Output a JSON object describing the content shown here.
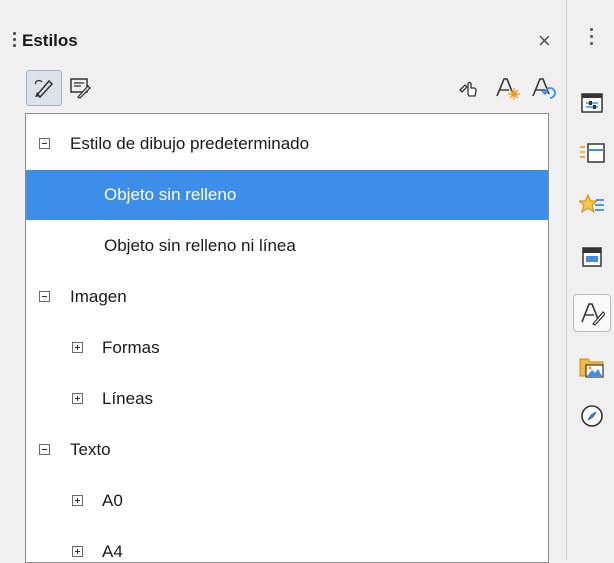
{
  "panel": {
    "title": "Estilos",
    "close_glyph": "×"
  },
  "toolbar": {
    "buttons": [
      {
        "icon": "drawing-styles-icon",
        "active": true
      },
      {
        "icon": "presentation-styles-icon",
        "active": false
      },
      {
        "icon": "fill-format-mode-icon",
        "active": false
      },
      {
        "icon": "new-style-from-selection-icon",
        "active": false
      },
      {
        "icon": "update-style-icon",
        "active": false
      }
    ]
  },
  "tree": {
    "items": [
      {
        "label": "Estilo de dibujo predeterminado",
        "level": 0,
        "toggle": "minus",
        "selected": false
      },
      {
        "label": "Objeto sin relleno",
        "level": 1,
        "toggle": null,
        "selected": true
      },
      {
        "label": "Objeto sin relleno ni línea",
        "level": 1,
        "toggle": null,
        "selected": false
      },
      {
        "label": "Imagen",
        "level": 0,
        "toggle": "minus",
        "selected": false
      },
      {
        "label": "Formas",
        "level": 1,
        "toggle": "plus",
        "selected": false
      },
      {
        "label": "Líneas",
        "level": 1,
        "toggle": "plus",
        "selected": false
      },
      {
        "label": "Texto",
        "level": 0,
        "toggle": "minus",
        "selected": false
      },
      {
        "label": "A0",
        "level": 1,
        "toggle": "plus",
        "selected": false
      },
      {
        "label": "A4",
        "level": 1,
        "toggle": "plus",
        "selected": false
      }
    ]
  },
  "sidebar": {
    "buttons": [
      {
        "icon": "properties-icon",
        "active": false
      },
      {
        "icon": "slide-transition-icon",
        "active": false
      },
      {
        "icon": "animation-icon",
        "active": false
      },
      {
        "icon": "master-slides-icon",
        "active": false
      },
      {
        "icon": "styles-icon",
        "active": true
      },
      {
        "icon": "gallery-icon",
        "active": false
      },
      {
        "icon": "navigator-icon",
        "active": false
      }
    ]
  },
  "colors": {
    "selection": "#3d8ee8",
    "accent_orange": "#f39c12"
  }
}
